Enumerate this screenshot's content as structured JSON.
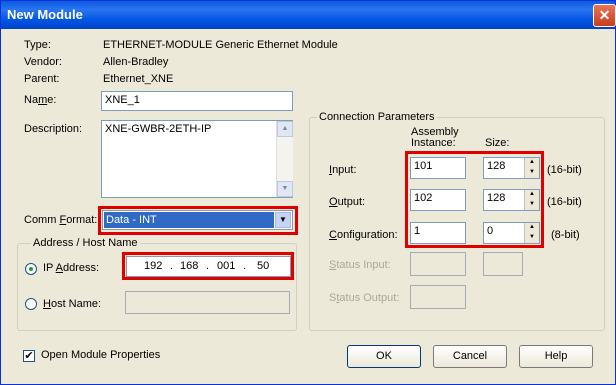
{
  "window": {
    "title": "New Module",
    "close_glyph": "✕"
  },
  "info": {
    "type_label": "Type:",
    "type_value": "ETHERNET-MODULE Generic Ethernet Module",
    "vendor_label": "Vendor:",
    "vendor_value": "Allen-Bradley",
    "parent_label": "Parent:",
    "parent_value": "Ethernet_XNE"
  },
  "name": {
    "label_pre": "Na",
    "label_u": "m",
    "label_post": "e:",
    "value": "XNE_1"
  },
  "description": {
    "label_pre": "Description:",
    "value": "XNE-GWBR-2ETH-IP"
  },
  "comm_format": {
    "label_pre": "Comm ",
    "label_u": "F",
    "label_post": "ormat:",
    "value": "Data - INT"
  },
  "address": {
    "group_title": "Address / Host Name",
    "ip_label_pre": "IP ",
    "ip_label_u": "A",
    "ip_label_post": "ddress:",
    "ip_octets": [
      "192",
      "168",
      "001",
      "50"
    ],
    "host_label_pre": "",
    "host_label_u": "H",
    "host_label_post": "ost Name:",
    "host_value": ""
  },
  "connection": {
    "group_title": "Connection Parameters",
    "col_instance_1": "Assembly",
    "col_instance_2": "Instance:",
    "col_size": "Size:",
    "rows": [
      {
        "label_u": "I",
        "label_post": "nput:",
        "instance": "101",
        "size": "128",
        "unit": "(16-bit)"
      },
      {
        "label_u": "O",
        "label_post": "utput:",
        "instance": "102",
        "size": "128",
        "unit": "(16-bit)"
      },
      {
        "label_u": "C",
        "label_post": "onfiguration:",
        "instance": "1",
        "size": "0",
        "unit": "(8-bit)"
      }
    ],
    "status_input_pre": "",
    "status_input_u": "S",
    "status_input_post": "tatus Input:",
    "status_output_pre": "S",
    "status_output_u": "t",
    "status_output_post": "atus Output:"
  },
  "footer": {
    "open_props_label": "Open Module Properties",
    "open_props_checked_glyph": "✔",
    "ok_label": "OK",
    "cancel_label": "Cancel",
    "help_label": "Help"
  }
}
